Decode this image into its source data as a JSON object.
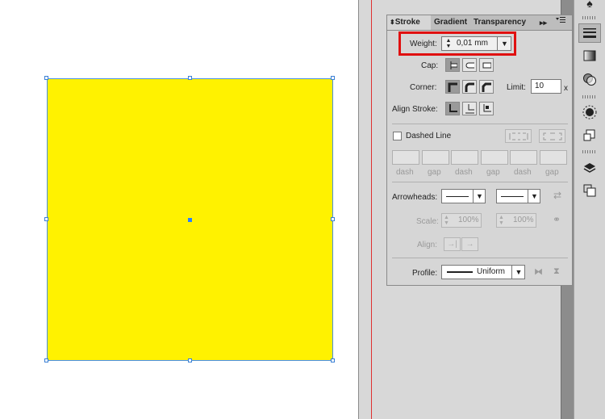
{
  "panel": {
    "tabs": [
      "Stroke",
      "Gradient",
      "Transparency"
    ],
    "menu_icon": "panel-menu-icon",
    "weight": {
      "label": "Weight:",
      "value": "0,01 mm"
    },
    "cap": {
      "label": "Cap:"
    },
    "corner": {
      "label": "Corner:",
      "limit_label": "Limit:",
      "limit_value": "10",
      "limit_unit": "x"
    },
    "align": {
      "label": "Align Stroke:"
    },
    "dashed": {
      "label": "Dashed Line",
      "sublabels": [
        "dash",
        "gap",
        "dash",
        "gap",
        "dash",
        "gap"
      ]
    },
    "arrowheads": {
      "label": "Arrowheads:"
    },
    "scale": {
      "label": "Scale:",
      "value1": "100%",
      "value2": "100%"
    },
    "align2": {
      "label": "Align:"
    },
    "profile": {
      "label": "Profile:",
      "value": "Uniform"
    }
  },
  "colors": {
    "fill": "#fff200",
    "accent": "#e01010",
    "selection": "#3a7fd5"
  }
}
